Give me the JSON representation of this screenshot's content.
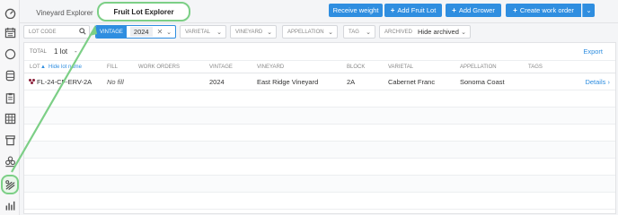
{
  "sidebar": {
    "icons": [
      {
        "name": "dashboard-icon"
      },
      {
        "name": "calendar-icon"
      },
      {
        "name": "circle-icon"
      },
      {
        "name": "barrel-icon"
      },
      {
        "name": "clipboard-icon"
      },
      {
        "name": "grid-icon"
      },
      {
        "name": "bin-icon"
      },
      {
        "name": "stack-icon"
      },
      {
        "name": "vineyard-icon"
      },
      {
        "name": "bar-chart-icon"
      }
    ],
    "active_icon": "vineyard-icon"
  },
  "tabs": [
    {
      "label": "Vineyard Explorer",
      "active": false
    },
    {
      "label": "Fruit Lot Explorer",
      "active": true
    }
  ],
  "toolbar": {
    "receive_weight": "Receive weight",
    "add_fruit_lot": "Add Fruit Lot",
    "add_grower": "Add Grower",
    "create_work_order": "Create work order",
    "plus": "+",
    "caret": "⌄"
  },
  "filters": {
    "lot_code_placeholder": "LOT CODE",
    "vintage_label": "VINTAGE",
    "vintage_value": "2024",
    "clear": "✕",
    "varietal": "VARIETAL",
    "vineyard": "VINEYARD",
    "appellation": "APPELLATION",
    "tag": "TAG",
    "archived_label": "ARCHIVED",
    "archived_value": "Hide archived",
    "chevron": "⌄"
  },
  "summary": {
    "total_label": "TOTAL",
    "count": "1 lot",
    "dash": "-",
    "export": "Export"
  },
  "table": {
    "columns": {
      "lot": "LOT",
      "hide_lot_name": "Hide lot name",
      "fill": "FILL",
      "work_orders": "WORK ORDERS",
      "vintage": "VINTAGE",
      "vineyard": "VINEYARD",
      "block": "BLOCK",
      "varietal": "VARIETAL",
      "appellation": "APPELLATION",
      "tags": "TAGS"
    },
    "rows": [
      {
        "lot": "FL-24-CF-ERV-2A",
        "fill": "No fill",
        "work_orders": "",
        "vintage": "2024",
        "vineyard": "East Ridge Vineyard",
        "block": "2A",
        "varietal": "Cabernet Franc",
        "appellation": "Sonoma Coast",
        "tags": "",
        "details": "Details"
      }
    ],
    "details_chevron": "›"
  },
  "colors": {
    "accent": "#2f8ee0",
    "highlight": "#7ccf86",
    "grape": "#8a1f3a"
  }
}
